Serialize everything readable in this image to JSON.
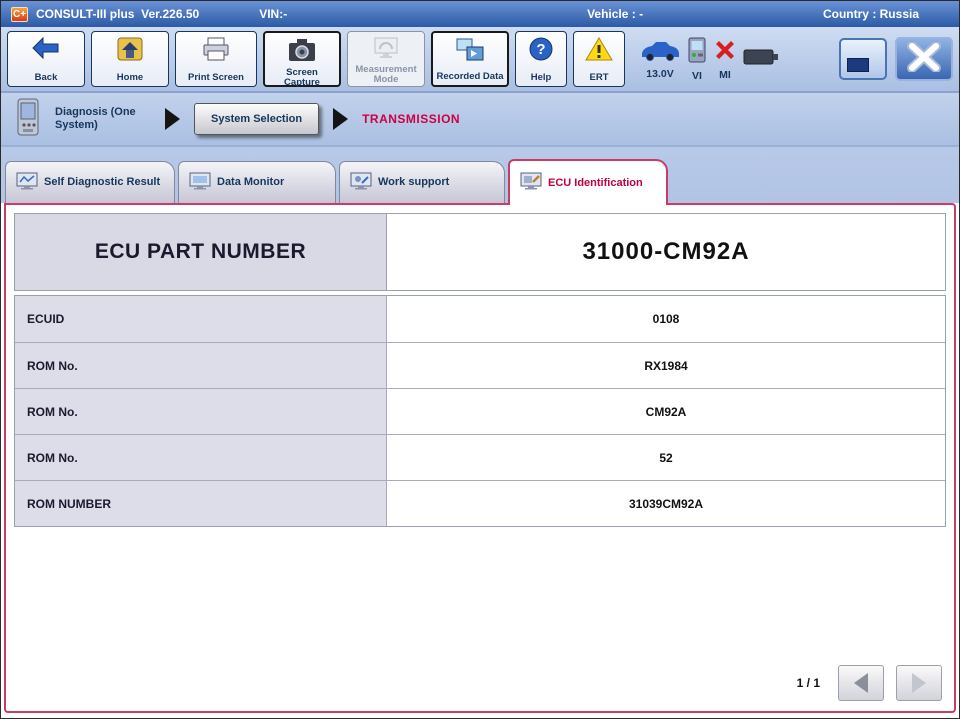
{
  "title_bar": {
    "logo": "C+",
    "app_name": "CONSULT-III plus",
    "version": "Ver.226.50",
    "vin": "VIN:-",
    "vehicle": "Vehicle : -",
    "country": "Country : Russia"
  },
  "toolbar": {
    "back": "Back",
    "home": "Home",
    "print_screen": "Print Screen",
    "screen_capture": "Screen Capture",
    "measurement_mode": "Measurement Mode",
    "recorded_data": "Recorded Data",
    "help": "Help",
    "ert": "ERT",
    "voltage": "13.0V",
    "vi_label": "VI",
    "mi_label": "MI"
  },
  "breadcrumb": {
    "step1": "Diagnosis (One System)",
    "step2": "System Selection",
    "system": "TRANSMISSION"
  },
  "tabs": [
    {
      "label": "Self Diagnostic Result"
    },
    {
      "label": "Data Monitor"
    },
    {
      "label": "Work support"
    },
    {
      "label": "ECU Identification"
    }
  ],
  "table": {
    "header_label": "ECU PART NUMBER",
    "header_value": "31000-CM92A",
    "rows": [
      {
        "label": "ECUID",
        "value": "0108"
      },
      {
        "label": "ROM No.",
        "value": "RX1984"
      },
      {
        "label": "ROM No.",
        "value": "CM92A"
      },
      {
        "label": "ROM No.",
        "value": "52"
      },
      {
        "label": "ROM NUMBER",
        "value": "31039CM92A"
      }
    ]
  },
  "pagination": {
    "page": "1 / 1"
  }
}
